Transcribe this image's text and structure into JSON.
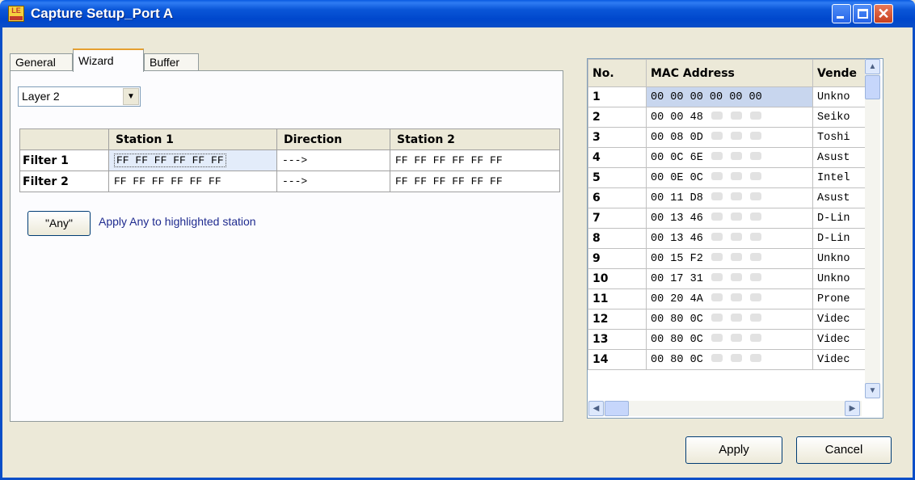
{
  "window": {
    "title": "Capture Setup_Port A",
    "icon": "LE"
  },
  "tabs": [
    {
      "label": "General",
      "active": false
    },
    {
      "label": "Wizard",
      "active": true
    },
    {
      "label": "Buffer",
      "active": false
    }
  ],
  "layer_select": {
    "value": "Layer 2"
  },
  "filter_grid": {
    "headers": [
      "",
      "Station 1",
      "Direction",
      "Station 2"
    ],
    "rows": [
      {
        "label": "Filter 1",
        "station1": "FF FF FF FF FF FF",
        "direction": "--->",
        "station2": "FF FF FF FF FF FF"
      },
      {
        "label": "Filter 2",
        "station1": "FF FF FF FF FF FF",
        "direction": "--->",
        "station2": "FF FF FF FF FF FF"
      }
    ]
  },
  "any_button": {
    "label": "\"Any\"",
    "hint": "Apply Any to highlighted  station"
  },
  "mac_list": {
    "headers": [
      "No.",
      "MAC Address",
      "Vende"
    ],
    "rows": [
      {
        "no": "1",
        "mac": "00 00 00 00 00 00",
        "vendor": "Unkno"
      },
      {
        "no": "2",
        "mac": "00 00 48",
        "vendor": "Seiko"
      },
      {
        "no": "3",
        "mac": "00 08 0D",
        "vendor": "Toshi"
      },
      {
        "no": "4",
        "mac": "00 0C 6E",
        "vendor": "Asust"
      },
      {
        "no": "5",
        "mac": "00 0E 0C",
        "vendor": "Intel"
      },
      {
        "no": "6",
        "mac": "00 11 D8",
        "vendor": "Asust"
      },
      {
        "no": "7",
        "mac": "00 13 46",
        "vendor": "D-Lin"
      },
      {
        "no": "8",
        "mac": "00 13 46",
        "vendor": "D-Lin"
      },
      {
        "no": "9",
        "mac": "00 15 F2",
        "vendor": "Unkno"
      },
      {
        "no": "10",
        "mac": "00 17 31",
        "vendor": "Unkno"
      },
      {
        "no": "11",
        "mac": "00 20 4A",
        "vendor": "Prone"
      },
      {
        "no": "12",
        "mac": "00 80 0C",
        "vendor": "Videc"
      },
      {
        "no": "13",
        "mac": "00 80 0C",
        "vendor": "Videc"
      },
      {
        "no": "14",
        "mac": "00 80 0C",
        "vendor": "Videc"
      }
    ]
  },
  "buttons": {
    "apply": "Apply",
    "cancel": "Cancel"
  }
}
